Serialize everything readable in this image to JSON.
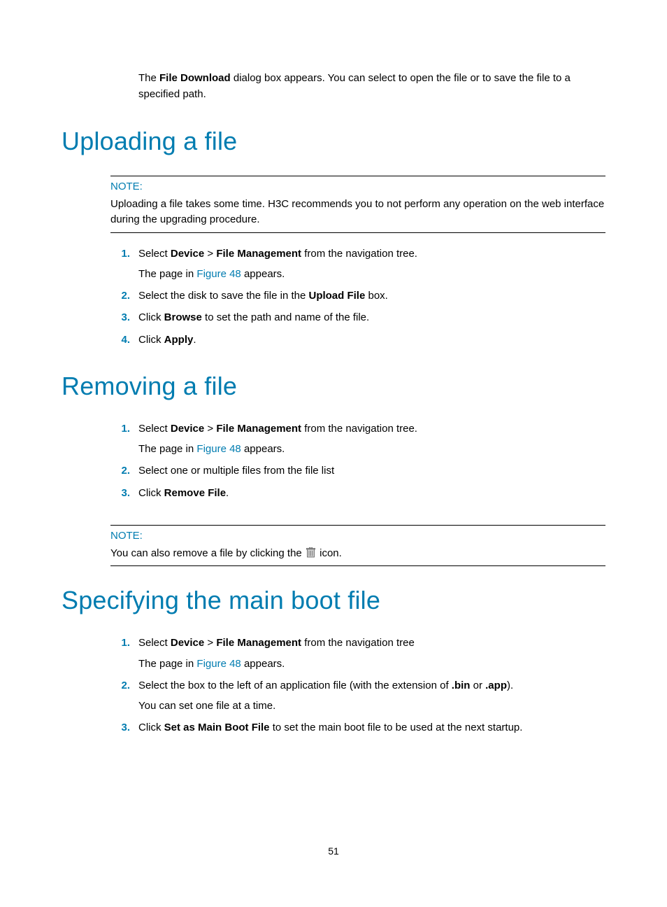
{
  "intro": {
    "pre": "The ",
    "bold": "File Download",
    "post": " dialog box appears. You can select to open the file or to save the file to a specified path."
  },
  "sections": {
    "uploading": {
      "title": "Uploading a file",
      "note": {
        "label": "NOTE:",
        "text": "Uploading a file takes some time. H3C recommends you to not perform any operation on the web interface during the upgrading procedure."
      },
      "steps": [
        {
          "num": "1.",
          "parts": [
            {
              "t": "plain",
              "v": "Select "
            },
            {
              "t": "bold",
              "v": "Device"
            },
            {
              "t": "plain",
              "v": " > "
            },
            {
              "t": "bold",
              "v": "File Management"
            },
            {
              "t": "plain",
              "v": " from the navigation tree."
            }
          ],
          "sub": {
            "pre": "The page in ",
            "link": "Figure 48",
            "post": " appears."
          }
        },
        {
          "num": "2.",
          "parts": [
            {
              "t": "plain",
              "v": "Select the disk to save the file in the "
            },
            {
              "t": "bold",
              "v": "Upload File"
            },
            {
              "t": "plain",
              "v": " box."
            }
          ]
        },
        {
          "num": "3.",
          "parts": [
            {
              "t": "plain",
              "v": " Click "
            },
            {
              "t": "bold",
              "v": "Browse"
            },
            {
              "t": "plain",
              "v": " to set the path and name of the file."
            }
          ]
        },
        {
          "num": "4.",
          "parts": [
            {
              "t": "plain",
              "v": "Click "
            },
            {
              "t": "bold",
              "v": "Apply"
            },
            {
              "t": "plain",
              "v": "."
            }
          ]
        }
      ]
    },
    "removing": {
      "title": "Removing a file",
      "steps": [
        {
          "num": "1.",
          "parts": [
            {
              "t": "plain",
              "v": "Select "
            },
            {
              "t": "bold",
              "v": "Device"
            },
            {
              "t": "plain",
              "v": " > "
            },
            {
              "t": "bold",
              "v": "File Management"
            },
            {
              "t": "plain",
              "v": " from the navigation tree."
            }
          ],
          "sub": {
            "pre": "The page in ",
            "link": "Figure 48",
            "post": " appears."
          }
        },
        {
          "num": "2.",
          "parts": [
            {
              "t": "plain",
              "v": "Select one or multiple files from the file list"
            }
          ]
        },
        {
          "num": "3.",
          "parts": [
            {
              "t": "plain",
              "v": "Click "
            },
            {
              "t": "bold",
              "v": "Remove File"
            },
            {
              "t": "plain",
              "v": "."
            }
          ]
        }
      ],
      "note": {
        "label": "NOTE:",
        "pre": "You can also remove a file by clicking the ",
        "post": " icon."
      }
    },
    "boot": {
      "title": "Specifying the main boot file",
      "steps": [
        {
          "num": "1.",
          "parts": [
            {
              "t": "plain",
              "v": "Select "
            },
            {
              "t": "bold",
              "v": "Device"
            },
            {
              "t": "plain",
              "v": " > "
            },
            {
              "t": "bold",
              "v": "File Management"
            },
            {
              "t": "plain",
              "v": " from the navigation tree"
            }
          ],
          "sub": {
            "pre": "The page in ",
            "link": "Figure 48",
            "post": " appears."
          }
        },
        {
          "num": "2.",
          "parts": [
            {
              "t": "plain",
              "v": "Select the box to the left of an application file (with the extension of "
            },
            {
              "t": "bold",
              "v": ".bin"
            },
            {
              "t": "plain",
              "v": " or "
            },
            {
              "t": "bold",
              "v": ".app"
            },
            {
              "t": "plain",
              "v": ")."
            }
          ],
          "sub_plain": "You can set one file at a time."
        },
        {
          "num": "3.",
          "parts": [
            {
              "t": "plain",
              "v": "Click "
            },
            {
              "t": "bold",
              "v": "Set as Main Boot File"
            },
            {
              "t": "plain",
              "v": " to set the main boot file to be used at the next startup."
            }
          ]
        }
      ]
    }
  },
  "pageNumber": "51"
}
